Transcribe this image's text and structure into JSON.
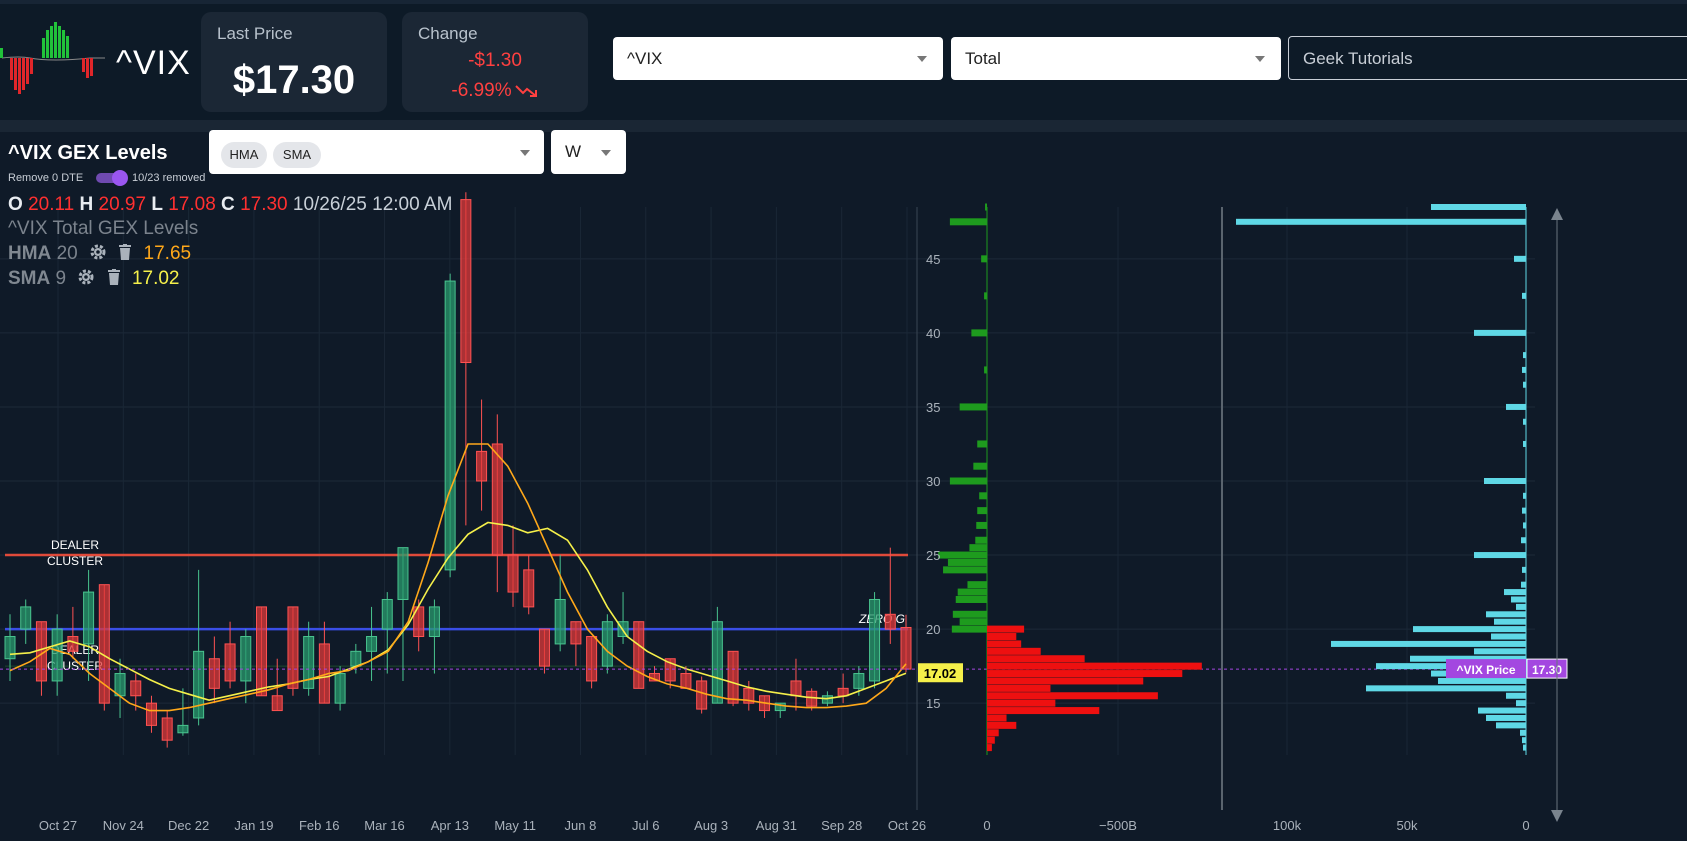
{
  "header": {
    "ticker": "^VIX",
    "last_price_label": "Last Price",
    "last_price": "$17.30",
    "change_label": "Change",
    "change_abs": "-$1.30",
    "change_pct": "-6.99%",
    "symbol_select": "^VIX",
    "gex_select": "Total",
    "tutorials_select": "Geek Tutorials"
  },
  "chart_panel": {
    "title": "^VIX GEX Levels",
    "remove_label": "Remove 0 DTE",
    "removed_text": "10/23 removed",
    "indicators": [
      "HMA",
      "SMA"
    ],
    "interval": "W",
    "ohlc": {
      "o_label": "O",
      "o": "20.11",
      "h_label": "H",
      "h": "20.97",
      "l_label": "L",
      "l": "17.08",
      "c_label": "C",
      "c": "17.30",
      "datetime": "10/26/25 12:00 AM"
    },
    "series_title": "^VIX Total GEX Levels",
    "hma": {
      "name": "HMA",
      "period": "20",
      "value": "17.65"
    },
    "sma": {
      "name": "SMA",
      "period": "9",
      "value": "17.02"
    }
  },
  "colors": {
    "up": "#2a9b6e",
    "down": "#e03a3a",
    "hma": "#ffa81a",
    "sma": "#f5f04a",
    "zero_gamma": "#3a4ee6",
    "cluster": "#e04a3a",
    "gex_pos": "#1e9b1e",
    "gex_neg": "#ee1010",
    "volume": "#5fd8e6",
    "price_tag": "#a347e0"
  },
  "chart_data": {
    "type": "candlestick",
    "x_labels": [
      "Oct 27",
      "Nov 24",
      "Dec 22",
      "Jan 19",
      "Feb 16",
      "Mar 16",
      "Apr 13",
      "May 11",
      "Jun 8",
      "Jul 6",
      "Aug 3",
      "Aug 31",
      "Sep 28",
      "Oct 26"
    ],
    "y_ticks": [
      15,
      20,
      25,
      30,
      35,
      40,
      45
    ],
    "ylim": [
      11.5,
      48.5
    ],
    "candles": [
      {
        "o": 18.0,
        "h": 21.0,
        "l": 16.5,
        "c": 19.5
      },
      {
        "o": 20.0,
        "h": 22.0,
        "l": 19.0,
        "c": 21.5
      },
      {
        "o": 20.5,
        "h": 20.5,
        "l": 15.5,
        "c": 16.5
      },
      {
        "o": 16.5,
        "h": 21.0,
        "l": 15.5,
        "c": 20.0
      },
      {
        "o": 19.5,
        "h": 21.5,
        "l": 18.0,
        "c": 18.5
      },
      {
        "o": 19.0,
        "h": 24.0,
        "l": 16.5,
        "c": 22.5
      },
      {
        "o": 23.0,
        "h": 23.0,
        "l": 14.5,
        "c": 15.0
      },
      {
        "o": 15.5,
        "h": 18.0,
        "l": 14.0,
        "c": 17.0
      },
      {
        "o": 16.5,
        "h": 17.0,
        "l": 14.5,
        "c": 15.5
      },
      {
        "o": 15.0,
        "h": 15.5,
        "l": 13.0,
        "c": 13.5
      },
      {
        "o": 14.0,
        "h": 14.5,
        "l": 12.0,
        "c": 12.5
      },
      {
        "o": 13.0,
        "h": 16.0,
        "l": 12.8,
        "c": 13.5
      },
      {
        "o": 14.0,
        "h": 24.0,
        "l": 13.5,
        "c": 18.5
      },
      {
        "o": 18.0,
        "h": 19.5,
        "l": 15.0,
        "c": 16.0
      },
      {
        "o": 19.0,
        "h": 20.5,
        "l": 16.0,
        "c": 16.5
      },
      {
        "o": 16.5,
        "h": 20.0,
        "l": 15.0,
        "c": 19.5
      },
      {
        "o": 21.5,
        "h": 21.5,
        "l": 15.5,
        "c": 15.5
      },
      {
        "o": 15.5,
        "h": 18.0,
        "l": 14.5,
        "c": 14.5
      },
      {
        "o": 21.5,
        "h": 21.5,
        "l": 15.5,
        "c": 16.0
      },
      {
        "o": 16.0,
        "h": 20.5,
        "l": 15.5,
        "c": 19.5
      },
      {
        "o": 19.0,
        "h": 20.5,
        "l": 15.0,
        "c": 15.0
      },
      {
        "o": 15.0,
        "h": 17.5,
        "l": 14.5,
        "c": 17.0
      },
      {
        "o": 17.5,
        "h": 19.0,
        "l": 17.0,
        "c": 18.5
      },
      {
        "o": 18.5,
        "h": 21.5,
        "l": 16.5,
        "c": 19.5
      },
      {
        "o": 20.0,
        "h": 22.5,
        "l": 17.0,
        "c": 22.0
      },
      {
        "o": 22.0,
        "h": 25.5,
        "l": 16.5,
        "c": 25.5
      },
      {
        "o": 21.5,
        "h": 22.0,
        "l": 18.5,
        "c": 19.5
      },
      {
        "o": 19.5,
        "h": 22.0,
        "l": 17.0,
        "c": 21.5
      },
      {
        "o": 24.0,
        "h": 44.0,
        "l": 23.5,
        "c": 43.5
      },
      {
        "o": 49.0,
        "h": 49.5,
        "l": 27.0,
        "c": 38.0
      },
      {
        "o": 32.0,
        "h": 35.5,
        "l": 28.0,
        "c": 30.0
      },
      {
        "o": 32.5,
        "h": 34.5,
        "l": 22.5,
        "c": 25.0
      },
      {
        "o": 25.0,
        "h": 27.0,
        "l": 21.5,
        "c": 22.5
      },
      {
        "o": 24.0,
        "h": 25.0,
        "l": 21.0,
        "c": 21.5
      },
      {
        "o": 20.0,
        "h": 20.0,
        "l": 17.0,
        "c": 17.5
      },
      {
        "o": 19.0,
        "h": 25.0,
        "l": 18.5,
        "c": 22.0
      },
      {
        "o": 20.5,
        "h": 20.5,
        "l": 17.5,
        "c": 19.0
      },
      {
        "o": 19.5,
        "h": 19.5,
        "l": 16.0,
        "c": 16.5
      },
      {
        "o": 17.5,
        "h": 21.0,
        "l": 17.0,
        "c": 20.5
      },
      {
        "o": 19.5,
        "h": 22.5,
        "l": 19.0,
        "c": 20.5
      },
      {
        "o": 20.5,
        "h": 20.5,
        "l": 16.0,
        "c": 16.0
      },
      {
        "o": 17.0,
        "h": 17.5,
        "l": 16.5,
        "c": 16.5
      },
      {
        "o": 18.0,
        "h": 18.0,
        "l": 16.0,
        "c": 16.5
      },
      {
        "o": 17.0,
        "h": 17.5,
        "l": 16.0,
        "c": 16.0
      },
      {
        "o": 16.5,
        "h": 16.8,
        "l": 14.3,
        "c": 14.6
      },
      {
        "o": 15.0,
        "h": 21.5,
        "l": 15.0,
        "c": 20.5
      },
      {
        "o": 18.5,
        "h": 18.5,
        "l": 14.8,
        "c": 15.0
      },
      {
        "o": 16.0,
        "h": 16.5,
        "l": 14.5,
        "c": 15.0
      },
      {
        "o": 15.5,
        "h": 15.5,
        "l": 14.0,
        "c": 14.5
      },
      {
        "o": 14.5,
        "h": 15.0,
        "l": 14.0,
        "c": 15.0
      },
      {
        "o": 16.5,
        "h": 18.0,
        "l": 14.5,
        "c": 15.5
      },
      {
        "o": 15.8,
        "h": 16.0,
        "l": 14.5,
        "c": 14.8
      },
      {
        "o": 15.0,
        "h": 15.8,
        "l": 14.8,
        "c": 15.5
      },
      {
        "o": 16.0,
        "h": 17.0,
        "l": 15.0,
        "c": 15.5
      },
      {
        "o": 16.0,
        "h": 17.5,
        "l": 15.5,
        "c": 17.0
      },
      {
        "o": 16.5,
        "h": 22.5,
        "l": 16.0,
        "c": 22.0
      },
      {
        "o": 21.0,
        "h": 25.5,
        "l": 19.0,
        "c": 20.0
      },
      {
        "o": 20.11,
        "h": 20.97,
        "l": 17.08,
        "c": 17.3
      }
    ],
    "hma_values": [
      17.2,
      17.8,
      18.7,
      18.3,
      17.0,
      16.0,
      15.0,
      14.5,
      14.5,
      14.7,
      15.0,
      15.3,
      15.6,
      15.9,
      16.3,
      16.6,
      17.0,
      17.2,
      17.8,
      18.5,
      20.5,
      24.5,
      29.0,
      32.5,
      32.5,
      31.0,
      28.5,
      25.5,
      22.5,
      20.0,
      18.5,
      17.5,
      16.8,
      16.3,
      16.0,
      15.6,
      15.3,
      15.2,
      15.0,
      14.8,
      14.7,
      14.7,
      14.8,
      15.0,
      16.0,
      17.65
    ],
    "sma_values": [
      18.3,
      18.4,
      18.8,
      19.2,
      18.8,
      18.0,
      17.3,
      16.6,
      16.0,
      15.6,
      15.2,
      15.5,
      15.8,
      16.1,
      16.3,
      16.6,
      16.8,
      17.3,
      17.8,
      18.6,
      20.3,
      22.7,
      24.8,
      26.4,
      27.2,
      27.0,
      26.5,
      26.8,
      26.0,
      24.0,
      21.5,
      19.5,
      18.5,
      17.8,
      17.3,
      16.9,
      16.5,
      16.1,
      15.8,
      15.6,
      15.4,
      15.3,
      15.5,
      16.0,
      16.5,
      17.02
    ],
    "levels": [
      {
        "label": "DEALER CLUSTER",
        "y": 25.0
      },
      {
        "label": "ZERO G",
        "y": 20.0
      },
      {
        "label": "DEALER CLUSTER",
        "y": 17.5
      }
    ],
    "price_line": 17.3,
    "sma_tag": "17.02",
    "gex_axis_labels": [
      "0",
      "−500B"
    ],
    "gex_profile": [
      {
        "strike": 48.5,
        "v": 2
      },
      {
        "strike": 47.5,
        "v": 38
      },
      {
        "strike": 45.0,
        "v": 6
      },
      {
        "strike": 42.5,
        "v": 3
      },
      {
        "strike": 40.0,
        "v": 16
      },
      {
        "strike": 37.5,
        "v": 3
      },
      {
        "strike": 35.0,
        "v": 28
      },
      {
        "strike": 32.5,
        "v": 10
      },
      {
        "strike": 31.0,
        "v": 14
      },
      {
        "strike": 30.0,
        "v": 38
      },
      {
        "strike": 29.0,
        "v": 8
      },
      {
        "strike": 28.0,
        "v": 10
      },
      {
        "strike": 27.0,
        "v": 11
      },
      {
        "strike": 26.0,
        "v": 12
      },
      {
        "strike": 25.5,
        "v": 18
      },
      {
        "strike": 25.0,
        "v": 50
      },
      {
        "strike": 24.5,
        "v": 40
      },
      {
        "strike": 24.0,
        "v": 45
      },
      {
        "strike": 23.0,
        "v": 20
      },
      {
        "strike": 22.5,
        "v": 30
      },
      {
        "strike": 22.0,
        "v": 32
      },
      {
        "strike": 21.0,
        "v": 35
      },
      {
        "strike": 20.5,
        "v": 28
      },
      {
        "strike": 20.0,
        "v": 36
      },
      {
        "strike": 20.0,
        "v": -38
      },
      {
        "strike": 19.5,
        "v": -30
      },
      {
        "strike": 19.0,
        "v": -35
      },
      {
        "strike": 18.5,
        "v": -55
      },
      {
        "strike": 18.0,
        "v": -100
      },
      {
        "strike": 17.5,
        "v": -220
      },
      {
        "strike": 17.0,
        "v": -200
      },
      {
        "strike": 16.5,
        "v": -160
      },
      {
        "strike": 16.0,
        "v": -65
      },
      {
        "strike": 15.5,
        "v": -175
      },
      {
        "strike": 15.0,
        "v": -70
      },
      {
        "strike": 14.5,
        "v": -115
      },
      {
        "strike": 14.0,
        "v": -20
      },
      {
        "strike": 13.5,
        "v": -30
      },
      {
        "strike": 13.0,
        "v": -12
      },
      {
        "strike": 12.5,
        "v": -8
      },
      {
        "strike": 12.0,
        "v": -5
      }
    ],
    "volume_axis_labels": [
      "100k",
      "50k",
      "0"
    ],
    "volume_profile": [
      {
        "strike": 48.5,
        "v": 95
      },
      {
        "strike": 47.5,
        "v": 290
      },
      {
        "strike": 45.0,
        "v": 12
      },
      {
        "strike": 42.5,
        "v": 4
      },
      {
        "strike": 40.0,
        "v": 52
      },
      {
        "strike": 38.5,
        "v": 3
      },
      {
        "strike": 37.5,
        "v": 4
      },
      {
        "strike": 36.5,
        "v": 3
      },
      {
        "strike": 35.0,
        "v": 20
      },
      {
        "strike": 34.0,
        "v": 3
      },
      {
        "strike": 32.5,
        "v": 3
      },
      {
        "strike": 30.0,
        "v": 42
      },
      {
        "strike": 29.0,
        "v": 3
      },
      {
        "strike": 28.0,
        "v": 4
      },
      {
        "strike": 27.0,
        "v": 3
      },
      {
        "strike": 26.0,
        "v": 5
      },
      {
        "strike": 25.0,
        "v": 52
      },
      {
        "strike": 24.0,
        "v": 4
      },
      {
        "strike": 23.0,
        "v": 5
      },
      {
        "strike": 22.5,
        "v": 22
      },
      {
        "strike": 22.0,
        "v": 15
      },
      {
        "strike": 21.5,
        "v": 10
      },
      {
        "strike": 21.0,
        "v": 40
      },
      {
        "strike": 20.5,
        "v": 32
      },
      {
        "strike": 20.0,
        "v": 113
      },
      {
        "strike": 19.5,
        "v": 35
      },
      {
        "strike": 19.0,
        "v": 195
      },
      {
        "strike": 18.5,
        "v": 52
      },
      {
        "strike": 18.0,
        "v": 116
      },
      {
        "strike": 17.5,
        "v": 150
      },
      {
        "strike": 17.0,
        "v": 95
      },
      {
        "strike": 16.5,
        "v": 88
      },
      {
        "strike": 16.0,
        "v": 160
      },
      {
        "strike": 15.5,
        "v": 20
      },
      {
        "strike": 15.0,
        "v": 10
      },
      {
        "strike": 14.5,
        "v": 48
      },
      {
        "strike": 14.0,
        "v": 40
      },
      {
        "strike": 13.5,
        "v": 30
      },
      {
        "strike": 13.0,
        "v": 6
      },
      {
        "strike": 12.5,
        "v": 4
      },
      {
        "strike": 12.0,
        "v": 3
      }
    ],
    "price_tag_label": "^VIX Price",
    "price_tag_value": "17.30"
  }
}
